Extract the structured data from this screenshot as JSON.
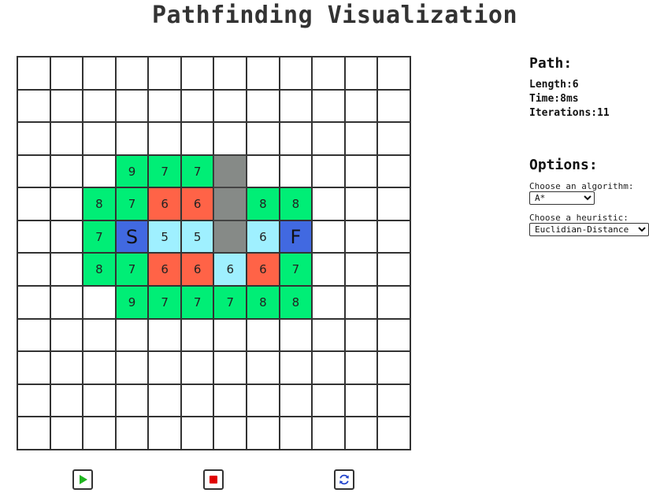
{
  "title": "Pathfinding Visualization",
  "grid": {
    "rows": 12,
    "cols": 12,
    "cells": [
      {
        "row": 3,
        "col": 3,
        "type": "open",
        "value": "9"
      },
      {
        "row": 3,
        "col": 4,
        "type": "open",
        "value": "7"
      },
      {
        "row": 3,
        "col": 5,
        "type": "open",
        "value": "7"
      },
      {
        "row": 3,
        "col": 6,
        "type": "wall",
        "value": ""
      },
      {
        "row": 4,
        "col": 2,
        "type": "open",
        "value": "8"
      },
      {
        "row": 4,
        "col": 3,
        "type": "open",
        "value": "7"
      },
      {
        "row": 4,
        "col": 4,
        "type": "closed",
        "value": "6"
      },
      {
        "row": 4,
        "col": 5,
        "type": "closed",
        "value": "6"
      },
      {
        "row": 4,
        "col": 6,
        "type": "wall",
        "value": ""
      },
      {
        "row": 4,
        "col": 7,
        "type": "open",
        "value": "8"
      },
      {
        "row": 4,
        "col": 8,
        "type": "open",
        "value": "8"
      },
      {
        "row": 5,
        "col": 2,
        "type": "open",
        "value": "7"
      },
      {
        "row": 5,
        "col": 3,
        "type": "start",
        "value": "S"
      },
      {
        "row": 5,
        "col": 4,
        "type": "path",
        "value": "5"
      },
      {
        "row": 5,
        "col": 5,
        "type": "path",
        "value": "5"
      },
      {
        "row": 5,
        "col": 6,
        "type": "wall",
        "value": ""
      },
      {
        "row": 5,
        "col": 7,
        "type": "path",
        "value": "6"
      },
      {
        "row": 5,
        "col": 8,
        "type": "finish",
        "value": "F"
      },
      {
        "row": 6,
        "col": 2,
        "type": "open",
        "value": "8"
      },
      {
        "row": 6,
        "col": 3,
        "type": "open",
        "value": "7"
      },
      {
        "row": 6,
        "col": 4,
        "type": "closed",
        "value": "6"
      },
      {
        "row": 6,
        "col": 5,
        "type": "closed",
        "value": "6"
      },
      {
        "row": 6,
        "col": 6,
        "type": "path",
        "value": "6"
      },
      {
        "row": 6,
        "col": 7,
        "type": "closed",
        "value": "6"
      },
      {
        "row": 6,
        "col": 8,
        "type": "open",
        "value": "7"
      },
      {
        "row": 7,
        "col": 3,
        "type": "open",
        "value": "9"
      },
      {
        "row": 7,
        "col": 4,
        "type": "open",
        "value": "7"
      },
      {
        "row": 7,
        "col": 5,
        "type": "open",
        "value": "7"
      },
      {
        "row": 7,
        "col": 6,
        "type": "open",
        "value": "7"
      },
      {
        "row": 7,
        "col": 7,
        "type": "open",
        "value": "8"
      },
      {
        "row": 7,
        "col": 8,
        "type": "open",
        "value": "8"
      }
    ]
  },
  "colors": {
    "open": "#00ee76",
    "closed": "#ff6347",
    "path": "#9ff0ff",
    "wall": "#868a87",
    "start_finish": "#4169e1"
  },
  "controls": [
    {
      "name": "play-button",
      "icon": "play-icon"
    },
    {
      "name": "stop-button",
      "icon": "stop-icon"
    },
    {
      "name": "reset-button",
      "icon": "refresh-icon"
    }
  ],
  "path": {
    "heading": "Path:",
    "length_label": "Length:",
    "length": "6",
    "time_label": "Time:",
    "time": "8ms",
    "iterations_label": "Iterations:",
    "iterations": "11"
  },
  "options": {
    "heading": "Options:",
    "algorithm_label": "Choose an algorithm:",
    "algorithm": "A*",
    "heuristic_label": "Choose a heuristic:",
    "heuristic": "Euclidian-Distance"
  }
}
